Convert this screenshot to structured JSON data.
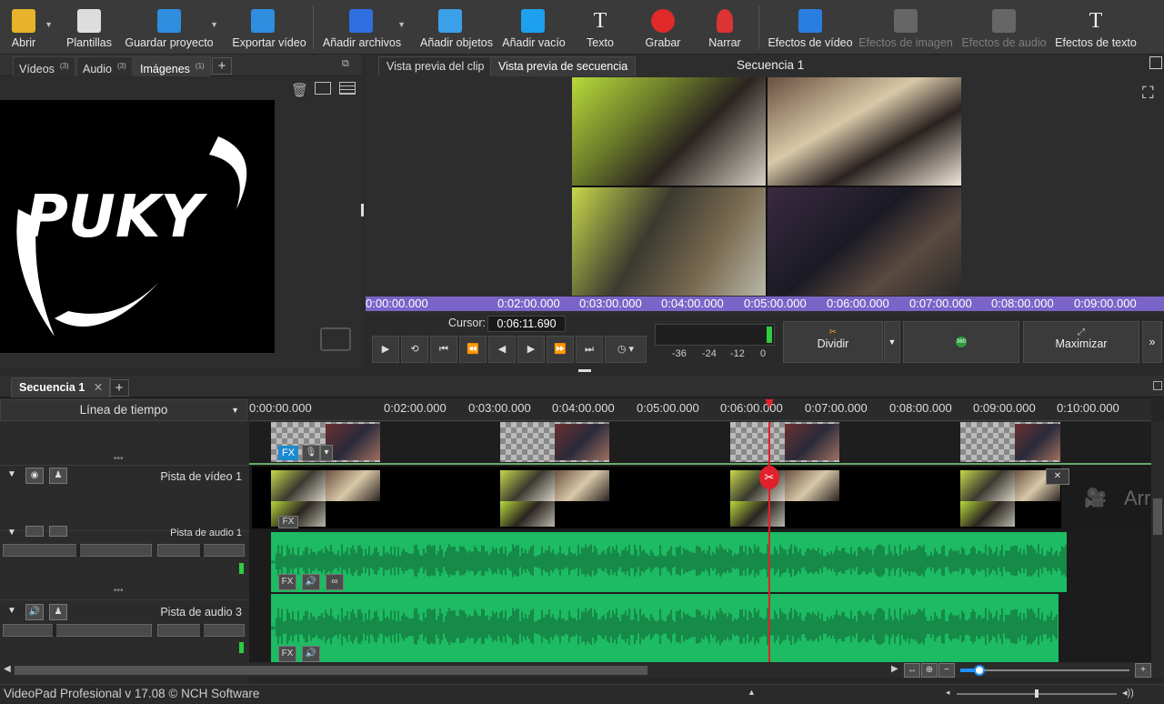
{
  "toolbar": {
    "items": [
      {
        "label": "Abrir",
        "icon": "folder-open-icon"
      },
      {
        "label": "Plantillas",
        "icon": "templates-icon"
      },
      {
        "label": "Guardar proyecto",
        "icon": "save-icon"
      },
      {
        "label": "Exportar vídeo",
        "icon": "export-video-icon"
      },
      {
        "label": "Añadir archivos",
        "icon": "add-files-icon"
      },
      {
        "label": "Añadir objetos",
        "icon": "add-objects-icon"
      },
      {
        "label": "Añadir vacío",
        "icon": "add-blank-icon"
      },
      {
        "label": "Texto",
        "icon": "text-icon"
      },
      {
        "label": "Grabar",
        "icon": "record-icon"
      },
      {
        "label": "Narrar",
        "icon": "microphone-icon"
      },
      {
        "label": "Efectos de vídeo",
        "icon": "video-effects-icon"
      },
      {
        "label": "Efectos de imagen",
        "icon": "image-effects-icon"
      },
      {
        "label": "Efectos de audio",
        "icon": "audio-effects-icon"
      },
      {
        "label": "Efectos de texto",
        "icon": "text-effects-icon"
      }
    ]
  },
  "bin": {
    "tabs": [
      {
        "label": "Vídeos",
        "count": "(3)"
      },
      {
        "label": "Audio",
        "count": "(3)"
      },
      {
        "label": "Imágenes",
        "count": "(1)"
      }
    ],
    "add_tab": "+",
    "image_logo_text": "PUKY"
  },
  "preview": {
    "tab_clip": "Vista previa del clip",
    "tab_sequence": "Vista previa de secuencia",
    "title": "Secuencia 1",
    "ruler": [
      "0:00:00.000",
      "0:02:00.000",
      "0:03:00.000",
      "0:04:00.000",
      "0:05:00.000",
      "0:06:00.000",
      "0:07:00.000",
      "0:08:00.000",
      "0:09:00.000"
    ],
    "cursor_label": "Cursor:",
    "cursor_value": "0:06:11.690",
    "meter_labels": [
      "-36",
      "-24",
      "-12",
      "0"
    ],
    "split_label": "Dividir",
    "vr_label": "360",
    "maximize_label": "Maximizar"
  },
  "timeline": {
    "tab": "Secuencia 1",
    "add_tab": "+",
    "mode": "Línea de tiempo",
    "ruler": [
      "0:00:00.000",
      "0:02:00.000",
      "0:03:00.000",
      "0:04:00.000",
      "0:05:00.000",
      "0:06:00.000",
      "0:07:00.000",
      "0:08:00.000",
      "0:09:00.000",
      "0:10:00.000"
    ],
    "video_track": "Pista de vídeo 1",
    "audio_track_1": "Pista de audio 1",
    "audio_track_3": "Pista de audio 3",
    "fx": "FX",
    "drop_hint": "Arr"
  },
  "status": {
    "text": "VideoPad Profesional v 17.08 © NCH Software"
  },
  "colors": {
    "accent_purple": "#7a64c8",
    "audio_green": "#1dbb63",
    "playhead_red": "#e0202a"
  }
}
